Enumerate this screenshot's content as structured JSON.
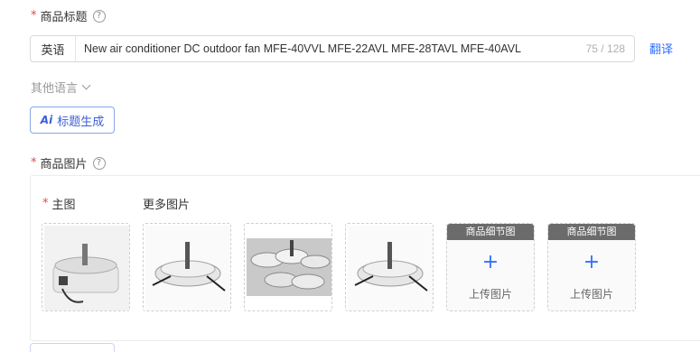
{
  "title_section": {
    "required": "*",
    "label": "商品标题",
    "help": "?"
  },
  "title_input": {
    "lang": "英语",
    "value": "New air conditioner DC outdoor fan MFE-40VVL MFE-22AVL MFE-28TAVL MFE-40AVL",
    "counter": "75 / 128"
  },
  "translate": "翻译",
  "other_languages": "其他语言",
  "ai_button": {
    "icon": "Ai",
    "label": "标题生成"
  },
  "images_section": {
    "required": "*",
    "label": "商品图片",
    "help": "?"
  },
  "main_image": {
    "required": "*",
    "label": "主图"
  },
  "more_images_label": "更多图片",
  "detail_slots": [
    {
      "header": "商品细节图",
      "plus": "+",
      "upload": "上传图片"
    },
    {
      "header": "商品细节图",
      "plus": "+",
      "upload": "上传图片"
    }
  ],
  "colors": {
    "accent": "#3370ff",
    "required": "#e5484d",
    "slot_header": "#6b6b6b"
  }
}
